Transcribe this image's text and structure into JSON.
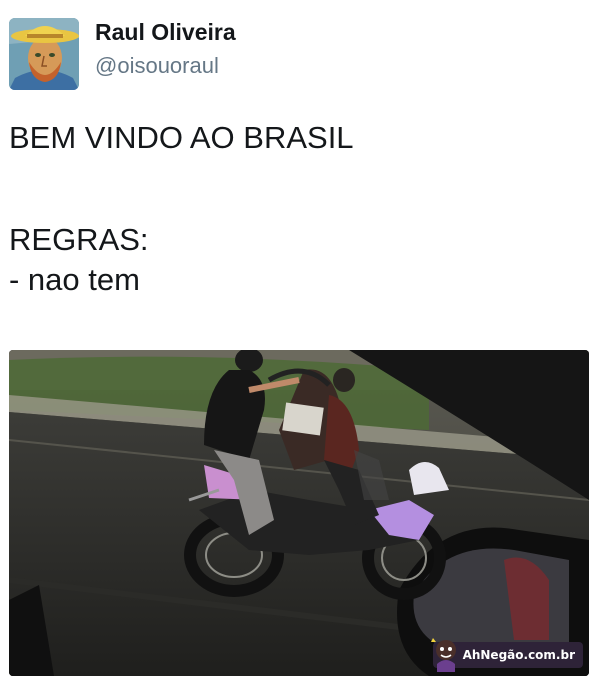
{
  "author": {
    "display_name": "Raul Oliveira",
    "handle": "@oisouoraul",
    "avatar_icon": "van-gogh-portrait-avatar"
  },
  "tweet": {
    "lines": [
      "BEM VINDO AO BRASIL",
      "REGRAS:",
      "- nao tem"
    ]
  },
  "media": {
    "description_icon": "photo-motorcycle-riders",
    "watermark": "AhNegão.com.br"
  },
  "colors": {
    "text": "#14171a",
    "secondary": "#657786",
    "motorcycle_accent": "#b48fe0"
  }
}
